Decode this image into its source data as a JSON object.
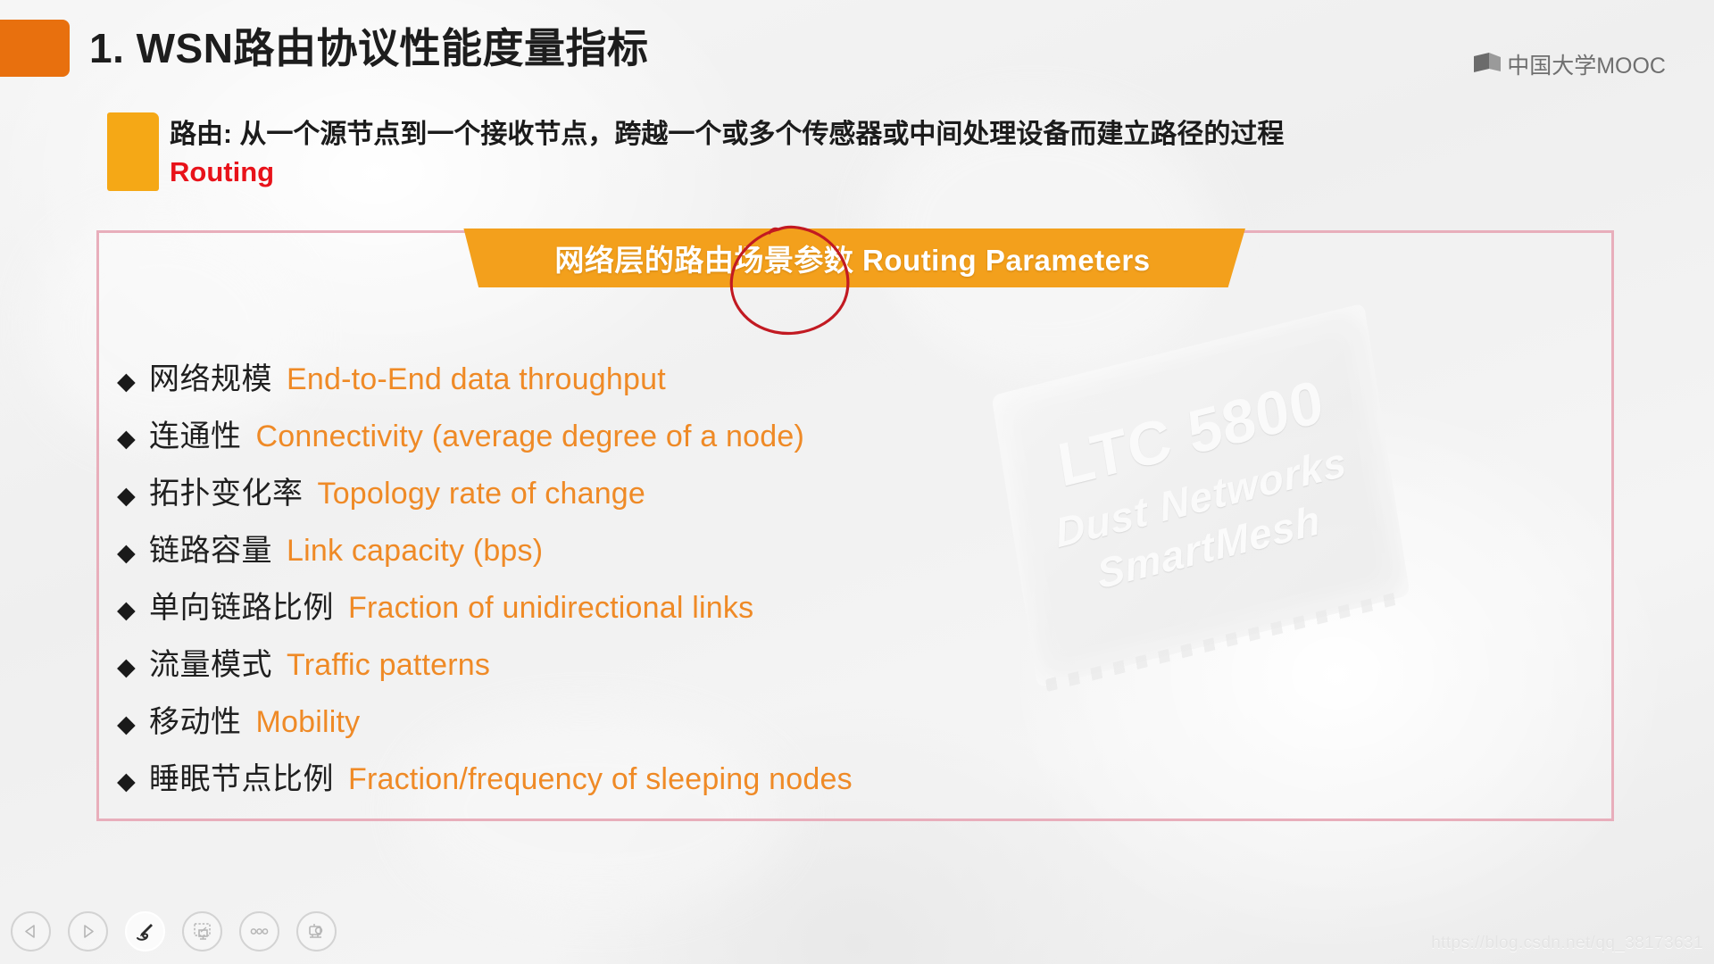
{
  "header": {
    "title": "1. WSN路由协议性能度量指标",
    "accent_color": "#e8700e",
    "logo": {
      "icon": "book-logo-icon",
      "text": "中国大学MOOC"
    }
  },
  "subtitle": {
    "accent_color": "#f5a816",
    "chinese": "路由: 从一个源节点到一个接收节点，跨越一个或多个传感器或中间处理设备而建立路径的过程",
    "english": "Routing",
    "english_color": "#e8121a"
  },
  "panel": {
    "border_color": "#e8aebb",
    "banner": {
      "text": "网络层的路由场景参数 Routing Parameters",
      "background_color": "#f3a01c",
      "text_color": "#ffffff"
    },
    "annotation": {
      "shape": "hand-drawn-circle",
      "color": "#c21a22",
      "targets": "场景参数"
    },
    "bullet_mark": "◆",
    "english_color": "#ef8a26",
    "items": [
      {
        "cn": "网络规模",
        "en": "End-to-End data throughput"
      },
      {
        "cn": "连通性",
        "en": "Connectivity (average degree of a node)"
      },
      {
        "cn": "拓扑变化率",
        "en": "Topology rate of change"
      },
      {
        "cn": "链路容量",
        "en": "Link capacity (bps)"
      },
      {
        "cn": "单向链路比例",
        "en": "Fraction of unidirectional links"
      },
      {
        "cn": "流量模式",
        "en": "Traffic patterns"
      },
      {
        "cn": "移动性",
        "en": "Mobility"
      },
      {
        "cn": "睡眠节点比例",
        "en": "Fraction/frequency of sleeping nodes"
      }
    ]
  },
  "background_chip": {
    "model": "LTC 5800",
    "brand": "Dust Networks",
    "family": "SmartMesh"
  },
  "toolbar": {
    "buttons": [
      {
        "name": "previous-slide-button",
        "icon": "triangle-left-icon",
        "active": false
      },
      {
        "name": "next-slide-button",
        "icon": "triangle-right-icon",
        "active": false
      },
      {
        "name": "pen-annotate-button",
        "icon": "pen-icon",
        "active": true
      },
      {
        "name": "screenshot-button",
        "icon": "screen-capture-icon",
        "active": false
      },
      {
        "name": "more-options-button",
        "icon": "ellipsis-icon",
        "active": false
      },
      {
        "name": "cast-button",
        "icon": "projector-icon",
        "active": false
      }
    ]
  },
  "watermark": {
    "url": "https://blog.csdn.net/qq_38173631"
  }
}
